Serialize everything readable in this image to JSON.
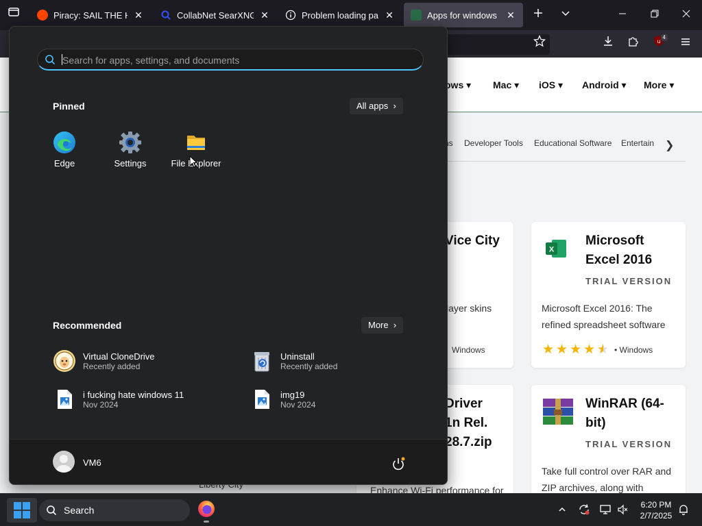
{
  "browser": {
    "tabs": [
      {
        "title": "Piracy: SAIL THE HIGH SEAS",
        "favicon": "reddit-icon"
      },
      {
        "title": "CollabNet SearXNG",
        "favicon": "search-icon"
      },
      {
        "title": "Problem loading page",
        "favicon": "info-icon"
      },
      {
        "title": "Apps for windows - CN",
        "favicon": "cnet-download-icon"
      }
    ],
    "extension_badge": "4"
  },
  "site": {
    "nav": [
      "ows",
      "Mac",
      "iOS",
      "Android",
      "More"
    ],
    "categories": [
      "ns",
      "Developer Tools",
      "Educational Software",
      "Entertain"
    ],
    "cards": [
      {
        "title_lines": [
          "Vice City"
        ],
        "desc_lines": [
          "layer skins"
        ],
        "platform": "Windows"
      },
      {
        "title_lines": [
          "Microsoft",
          "Excel 2016"
        ],
        "trial": "TRIAL VERSION",
        "desc_lines": [
          "Microsoft Excel 2016: The",
          "refined spreadsheet software"
        ],
        "rating": 4.5,
        "platform": "Windows"
      },
      {
        "title_lines": [
          "Driver",
          "1n Rel.",
          "28.7.zip"
        ],
        "desc_lines": [
          "Enhance Wi-Fi performance for"
        ]
      },
      {
        "title_lines": [
          "WinRAR (64-",
          "bit)"
        ],
        "trial": "TRIAL VERSION",
        "desc_lines": [
          "Take full control over RAR and",
          "ZIP archives, along with"
        ]
      }
    ],
    "partial_text": "Liberty City"
  },
  "start_menu": {
    "search_placeholder": "Search for apps, settings, and documents",
    "pinned_heading": "Pinned",
    "all_apps_label": "All apps",
    "pinned": [
      {
        "label": "Edge",
        "icon": "edge-icon"
      },
      {
        "label": "Settings",
        "icon": "settings-gear-icon"
      },
      {
        "label": "File Explorer",
        "icon": "folder-icon"
      }
    ],
    "recommended_heading": "Recommended",
    "more_label": "More",
    "recommended": [
      {
        "title": "Virtual CloneDrive",
        "subtitle": "Recently added",
        "icon": "sheep-icon"
      },
      {
        "title": "Uninstall",
        "subtitle": "Recently added",
        "icon": "uninstall-icon"
      },
      {
        "title": "i fucking hate windows 11",
        "subtitle": "Nov 2024",
        "icon": "image-file-icon"
      },
      {
        "title": "img19",
        "subtitle": "Nov 2024",
        "icon": "image-file-icon"
      }
    ],
    "user_name": "VM6"
  },
  "taskbar": {
    "search_label": "Search",
    "time": "6:20 PM",
    "date": "2/7/2025"
  },
  "colors": {
    "accent": "#4cc2ff",
    "star": "#f5b400",
    "excel_green": "#107c41"
  }
}
